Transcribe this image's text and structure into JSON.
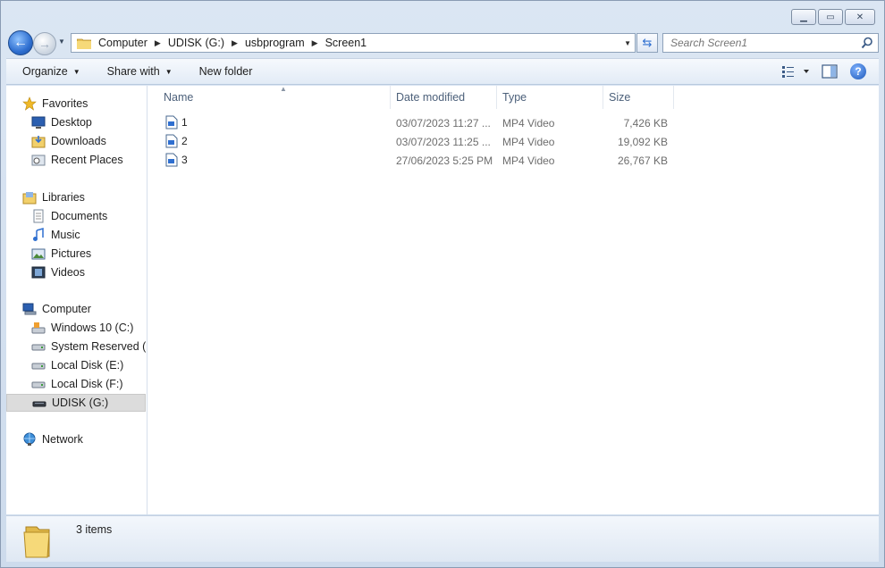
{
  "window": {
    "caption": {
      "minimize": "▁",
      "maximize": "▭",
      "close": "✕"
    }
  },
  "navigation": {
    "back_icon": "arrow-left-icon",
    "forward_icon": "arrow-right-icon",
    "breadcrumb": [
      "Computer",
      "UDISK (G:)",
      "usbprogram",
      "Screen1"
    ],
    "search_placeholder": "Search Screen1"
  },
  "toolbar": {
    "organize_label": "Organize",
    "share_label": "Share with",
    "new_folder_label": "New folder"
  },
  "sidebar": {
    "favorites": {
      "label": "Favorites",
      "items": [
        "Desktop",
        "Downloads",
        "Recent Places"
      ]
    },
    "libraries": {
      "label": "Libraries",
      "items": [
        "Documents",
        "Music",
        "Pictures",
        "Videos"
      ]
    },
    "computer": {
      "label": "Computer",
      "items": [
        "Windows 10 (C:)",
        "System Reserved (D:",
        "Local Disk (E:)",
        "Local Disk (F:)",
        "UDISK (G:)"
      ],
      "selected": "UDISK (G:)"
    },
    "network": {
      "label": "Network"
    }
  },
  "file_list": {
    "columns": [
      "Name",
      "Date modified",
      "Type",
      "Size"
    ],
    "rows": [
      {
        "name": "1",
        "date": "03/07/2023 11:27 ...",
        "type": "MP4 Video",
        "size": "7,426 KB"
      },
      {
        "name": "2",
        "date": "03/07/2023 11:25 ...",
        "type": "MP4 Video",
        "size": "19,092 KB"
      },
      {
        "name": "3",
        "date": "27/06/2023 5:25 PM",
        "type": "MP4 Video",
        "size": "26,767 KB"
      }
    ]
  },
  "details_pane": {
    "item_count": "3 items"
  },
  "colors": {
    "accent": "#2f6fd0",
    "selection": "#dcdcdc",
    "header_text": "#4c607a"
  }
}
